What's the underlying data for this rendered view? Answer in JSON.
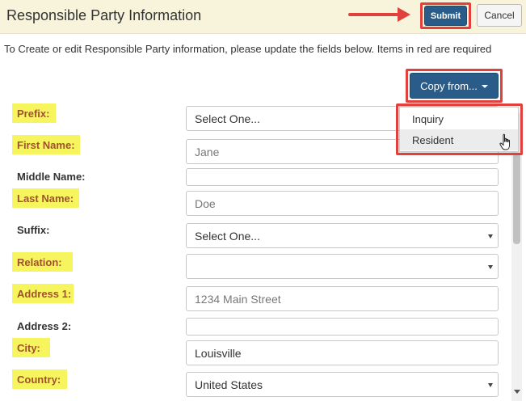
{
  "header": {
    "title": "Responsible Party Information",
    "submit_label": "Submit",
    "cancel_label": "Cancel"
  },
  "instructions": "To Create or edit Responsible Party information, please update the fields below. Items in red are required",
  "copy_from": {
    "label": "Copy from...",
    "options": [
      "Inquiry",
      "Resident"
    ],
    "hovered": "Resident"
  },
  "form": {
    "prefix": {
      "label": "Prefix:",
      "value": "Select One..."
    },
    "first_name": {
      "label": "First Name:",
      "value": "Jane"
    },
    "middle_name": {
      "label": "Middle Name:",
      "value": ""
    },
    "last_name": {
      "label": "Last Name:",
      "value": "Doe"
    },
    "suffix": {
      "label": "Suffix:",
      "value": "Select One..."
    },
    "relation": {
      "label": "Relation:",
      "value": ""
    },
    "address1": {
      "label": "Address 1:",
      "value": "1234 Main Street"
    },
    "address2": {
      "label": "Address 2:",
      "value": ""
    },
    "city": {
      "label": "City:",
      "value": "Louisville"
    },
    "country": {
      "label": "Country:",
      "value": "United States"
    }
  },
  "colors": {
    "header_bg": "#f8f4dc",
    "primary_button": "#2a5c8a",
    "annotation_red": "#e0413d",
    "highlight_yellow": "#f7f55e",
    "required_label": "#a0522d"
  },
  "icons": [
    "arrow-annotation-icon",
    "caret-down-icon",
    "select-arrow-icon",
    "hand-cursor-icon"
  ]
}
